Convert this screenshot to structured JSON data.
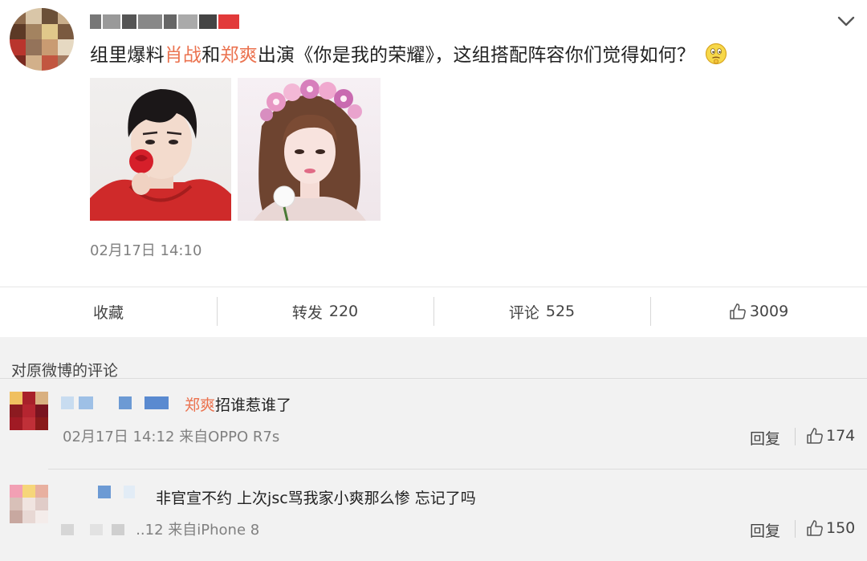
{
  "post": {
    "text_before": "组里爆料",
    "name1": "肖战",
    "text_mid": "和",
    "name2": "郑爽",
    "text_after": "出演《你是我的荣耀》，这组搭配阵容你们觉得如何？",
    "emoji": "thinking-face-icon",
    "time": "02月17日 14:10"
  },
  "actions": {
    "favorite_label": "收藏",
    "repost_label": "转发",
    "repost_count": "220",
    "comment_label": "评论",
    "comment_count": "525",
    "like_count": "3009"
  },
  "comments_section": {
    "title": "对原微博的评论",
    "comments": [
      {
        "highlight": "郑爽",
        "text": "招谁惹谁了",
        "meta": "02月17日 14:12 来自OPPO R7s",
        "reply_label": "回复",
        "likes": "174"
      },
      {
        "text": "非官宣不约 上次jsc骂我家小爽那么惨 忘记了吗",
        "meta": "..12 来自iPhone 8",
        "reply_label": "回复",
        "likes": "150"
      }
    ]
  },
  "colors": {
    "highlight": "#eb7350",
    "muted": "#808080",
    "band": "#f2f2f2"
  }
}
